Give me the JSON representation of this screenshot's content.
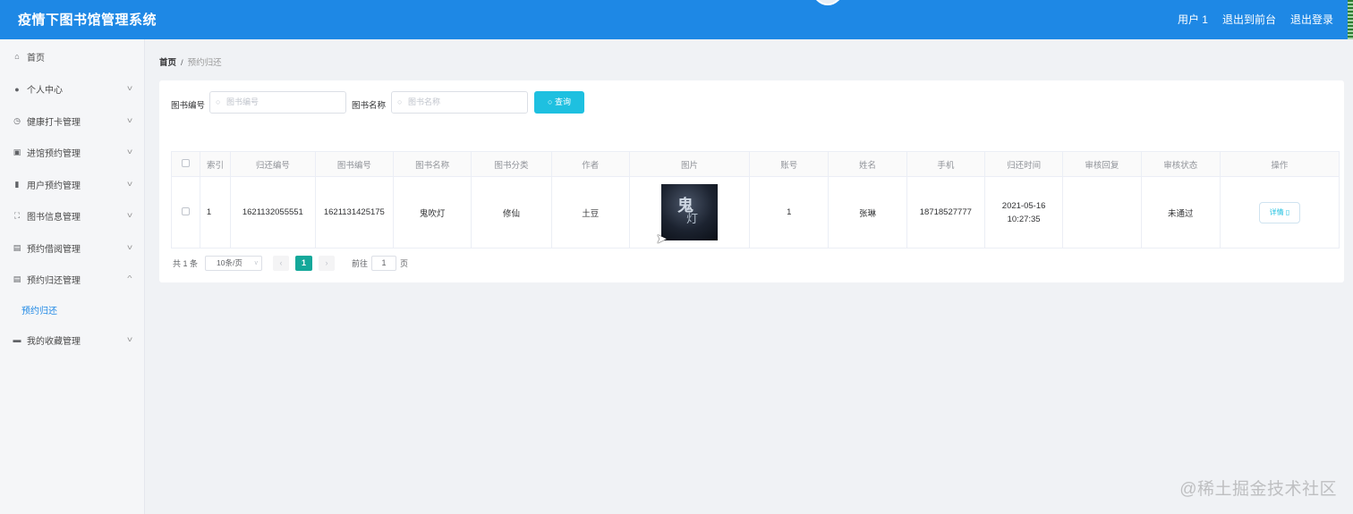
{
  "header": {
    "title": "疫情下图书馆管理系统",
    "user": "用户 1",
    "to_front": "退出到前台",
    "logout": "退出登录"
  },
  "sidebar": {
    "items": [
      {
        "label": "首页",
        "icon": "home-icon"
      },
      {
        "label": "个人中心",
        "icon": "user-icon"
      },
      {
        "label": "健康打卡管理",
        "icon": "clock-icon"
      },
      {
        "label": "进馆预约管理",
        "icon": "briefcase-icon"
      },
      {
        "label": "用户预约管理",
        "icon": "bar-chart-icon"
      },
      {
        "label": "图书信息管理",
        "icon": "fullscreen-icon"
      },
      {
        "label": "预约借阅管理",
        "icon": "clipboard-icon"
      },
      {
        "label": "预约归还管理",
        "icon": "clipboard-icon"
      },
      {
        "label": "预约归还",
        "icon": ""
      },
      {
        "label": "我的收藏管理",
        "icon": "monitor-icon"
      }
    ]
  },
  "breadcrumb": {
    "home": "首页",
    "sep": "/",
    "current": "预约归还"
  },
  "search": {
    "book_no_label": "图书编号",
    "book_no_placeholder": "图书编号",
    "book_name_label": "图书名称",
    "book_name_placeholder": "图书名称",
    "button": "查询"
  },
  "table": {
    "headers": [
      "索引",
      "归还编号",
      "图书编号",
      "图书名称",
      "图书分类",
      "作者",
      "图片",
      "账号",
      "姓名",
      "手机",
      "归还时间",
      "审核回复",
      "审核状态",
      "操作"
    ],
    "rows": [
      {
        "index": "1",
        "return_no": "1621132055551",
        "book_no": "1621131425175",
        "book_name": "鬼吹灯",
        "category": "修仙",
        "author": "土豆",
        "account": "1",
        "name": "张琳",
        "phone": "18718527777",
        "return_time": "2021-05-16 10:27:35",
        "review_reply": "",
        "review_status": "未通过",
        "action": "详情"
      }
    ]
  },
  "pager": {
    "total": "共 1 条",
    "page_size": "10条/页",
    "current": "1",
    "goto_prefix": "前往",
    "goto_value": "1",
    "goto_suffix": "页",
    "prev": "‹",
    "next": "›"
  },
  "watermark": "@稀土掘金技术社区",
  "colors": {
    "header": "#1e88e5",
    "accent": "#1ec0e0",
    "page_active": "#14a89a"
  }
}
